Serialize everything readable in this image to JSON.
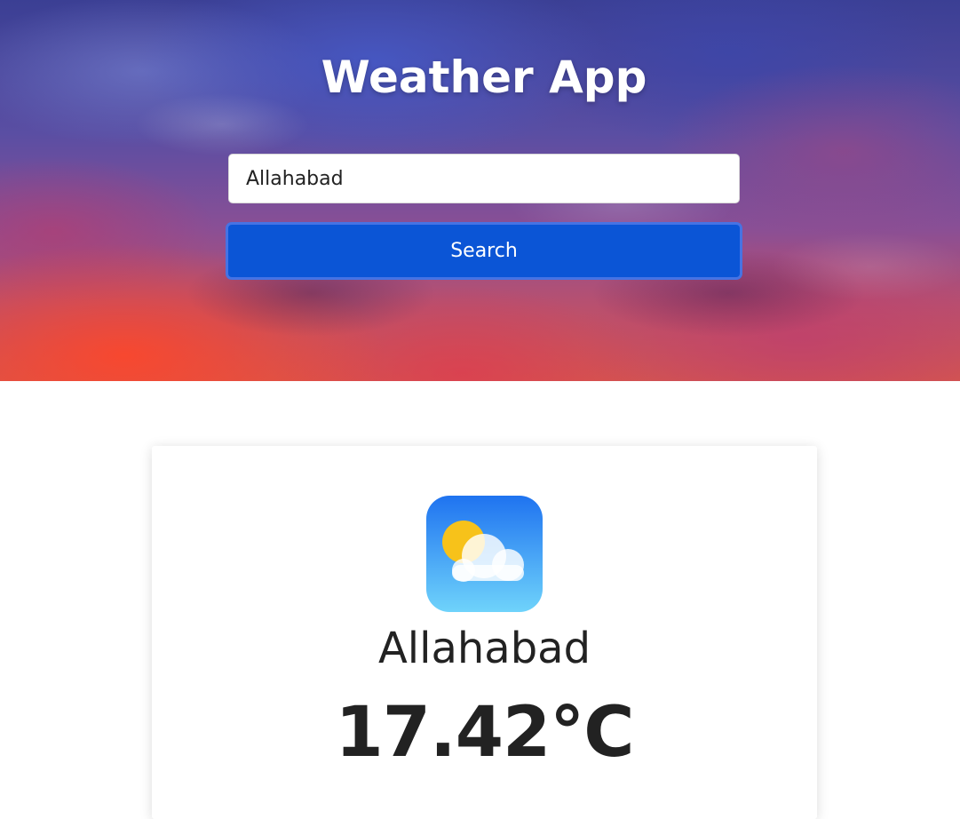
{
  "header": {
    "title": "Weather App"
  },
  "search": {
    "value": "Allahabad",
    "button_label": "Search"
  },
  "weather": {
    "icon": "partly-cloudy-icon",
    "city": "Allahabad",
    "temperature": "17.42°C"
  },
  "colors": {
    "button": "#0b55d6",
    "text": "#222222"
  }
}
